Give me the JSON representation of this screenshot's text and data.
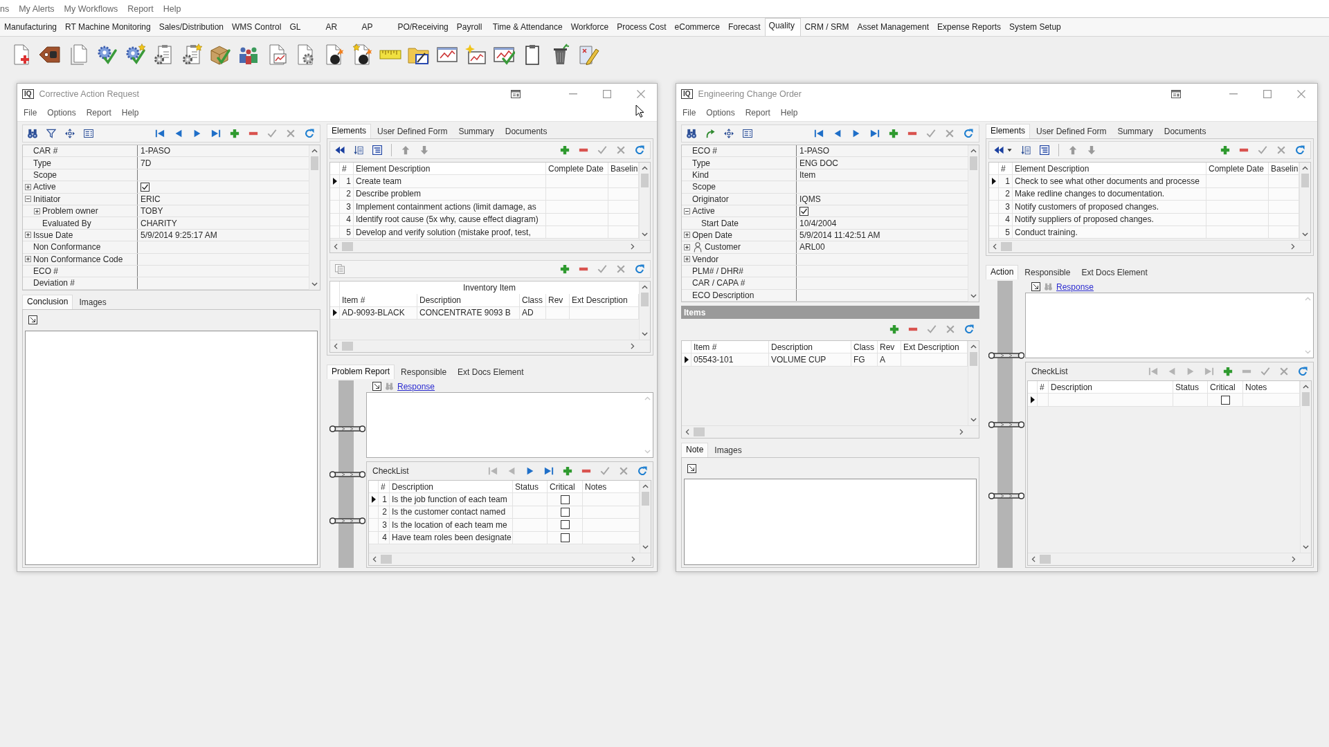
{
  "menu": [
    "ns",
    "My Alerts",
    "My Workflows",
    "Report",
    "Help"
  ],
  "modules": [
    {
      "label": "Manufacturing",
      "selected": false
    },
    {
      "label": "RT Machine Monitoring",
      "selected": false
    },
    {
      "label": "Sales/Distribution",
      "selected": false
    },
    {
      "label": "WMS Control",
      "selected": false
    },
    {
      "label": "GL",
      "selected": false
    },
    {
      "label": "AR",
      "selected": false
    },
    {
      "label": "AP",
      "selected": false
    },
    {
      "label": "PO/Receiving",
      "selected": false
    },
    {
      "label": "Payroll",
      "selected": false
    },
    {
      "label": "Time & Attendance",
      "selected": false
    },
    {
      "label": "Workforce",
      "selected": false
    },
    {
      "label": "Process Cost",
      "selected": false
    },
    {
      "label": "eCommerce",
      "selected": false
    },
    {
      "label": "Forecast",
      "selected": false
    },
    {
      "label": "Quality",
      "selected": true
    },
    {
      "label": "CRM / SRM",
      "selected": false
    },
    {
      "label": "Asset Management",
      "selected": false
    },
    {
      "label": "Expense Reports",
      "selected": false
    },
    {
      "label": "System Setup",
      "selected": false
    }
  ],
  "windows": [
    {
      "logo": "IQ",
      "title": "Corrective Action Request",
      "menu": [
        "File",
        "Options",
        "Report",
        "Help"
      ],
      "record": {
        "rows": [
          {
            "kind": "text",
            "label": "CAR #",
            "value": "1-PASO"
          },
          {
            "kind": "text",
            "label": "Type",
            "value": "7D"
          },
          {
            "kind": "text",
            "label": "Scope"
          },
          {
            "kind": "check",
            "label": "Active",
            "expanded": false,
            "checked": true
          },
          {
            "kind": "text",
            "label": "Initiator",
            "value": "ERIC",
            "expanded": true,
            "children": [
              {
                "kind": "text",
                "label": "Problem owner",
                "value": "TOBY",
                "expanded": false
              },
              {
                "kind": "text",
                "label": "Evaluated By",
                "value": "CHARITY"
              }
            ]
          },
          {
            "kind": "text",
            "label": "Issue Date",
            "value": "5/9/2014 9:25:17 AM",
            "expanded": false
          },
          {
            "kind": "text",
            "label": "Non Conformance"
          },
          {
            "kind": "text",
            "label": "Non Conformance Code",
            "expanded": false
          },
          {
            "kind": "text",
            "label": "ECO #"
          },
          {
            "kind": "text",
            "label": "Deviation #"
          }
        ]
      },
      "notes": {
        "tabs": [
          {
            "label": "Conclusion",
            "selected": true
          },
          {
            "label": "Images",
            "selected": false
          }
        ]
      },
      "elements": {
        "tabs": [
          {
            "label": "Elements",
            "selected": true
          },
          {
            "label": "User Defined Form",
            "selected": false
          },
          {
            "label": "Summary",
            "selected": false
          },
          {
            "label": "Documents",
            "selected": false
          }
        ],
        "columns": [
          "#",
          "Element Description",
          "Complete Date",
          "Baselin"
        ],
        "rows": [
          {
            "number": "1",
            "description": "Create team",
            "current": true
          },
          {
            "number": "2",
            "description": "Describe problem",
            "current": false
          },
          {
            "number": "3",
            "description": "Implement containment actions (limit damage, as",
            "current": false
          },
          {
            "number": "4",
            "description": "Identify root cause (5x why, cause effect diagram)",
            "current": false
          },
          {
            "number": "5",
            "description": "Develop and verify solution (mistake proof, test,",
            "current": false
          }
        ]
      },
      "inventory": {
        "group": "Inventory Item",
        "columns": [
          "Item #",
          "Description",
          "Class",
          "Rev",
          "Ext Description"
        ],
        "rows": [
          {
            "cells": [
              "AD-9093-BLACK",
              "CONCENTRATE 9093 B",
              "AD"
            ],
            "current": true
          }
        ]
      },
      "detail": {
        "tabs": [
          {
            "label": "Problem Report",
            "selected": true
          },
          {
            "label": "Responsible",
            "selected": false
          },
          {
            "label": "Ext Docs Element",
            "selected": false
          }
        ],
        "link": "Response",
        "checklist": {
          "title": "CheckList",
          "back_enabled": false,
          "forward_enabled": true,
          "delete_enabled": true,
          "columns": [
            "#",
            "Description",
            "Status",
            "Critical",
            "Notes"
          ],
          "rows": [
            {
              "number": "1",
              "description": "Is the job function of each team",
              "critical": false,
              "current": true
            },
            {
              "number": "2",
              "description": "Is the customer contact named",
              "critical": false,
              "current": false
            },
            {
              "number": "3",
              "description": "Is the location of each team me",
              "critical": false,
              "current": false
            },
            {
              "number": "4",
              "description": "Have team roles been designate",
              "critical": false,
              "current": false
            }
          ]
        }
      }
    },
    {
      "logo": "IQ",
      "title": "Engineering Change Order",
      "menu": [
        "File",
        "Options",
        "Report",
        "Help"
      ],
      "record": {
        "rows": [
          {
            "kind": "text",
            "label": "ECO #",
            "value": "1-PASO"
          },
          {
            "kind": "text",
            "label": "Type",
            "value": "ENG DOC"
          },
          {
            "kind": "text",
            "label": "Kind",
            "value": "Item"
          },
          {
            "kind": "text",
            "label": "Scope"
          },
          {
            "kind": "text",
            "label": "Originator",
            "value": "IQMS"
          },
          {
            "kind": "check",
            "label": "Active",
            "expanded": true,
            "checked": true,
            "children": [
              {
                "kind": "text",
                "label": "Start Date",
                "value": "10/4/2004"
              }
            ]
          },
          {
            "kind": "text",
            "label": "Open Date",
            "value": "5/9/2014 11:42:51 AM",
            "expanded": false
          },
          {
            "kind": "person",
            "label": "Customer",
            "value": "ARL00",
            "expanded": false
          },
          {
            "kind": "text",
            "label": "Vendor",
            "expanded": false
          },
          {
            "kind": "text",
            "label": "PLM# / DHR#"
          },
          {
            "kind": "text",
            "label": "CAR / CAPA #"
          },
          {
            "kind": "text",
            "label": "ECO Description"
          }
        ]
      },
      "items": {
        "title": "Items",
        "columns": [
          "Item #",
          "Description",
          "Class",
          "Rev",
          "Ext Description"
        ],
        "rows": [
          {
            "cells": [
              "05543-101",
              "VOLUME CUP",
              "FG",
              "A"
            ],
            "current": true
          }
        ]
      },
      "notes": {
        "tabs": [
          {
            "label": "Note",
            "selected": true
          },
          {
            "label": "Images",
            "selected": false
          }
        ]
      },
      "elements": {
        "tabs": [
          {
            "label": "Elements",
            "selected": true
          },
          {
            "label": "User Defined Form",
            "selected": false
          },
          {
            "label": "Summary",
            "selected": false
          },
          {
            "label": "Documents",
            "selected": false
          }
        ],
        "columns": [
          "#",
          "Element Description",
          "Complete Date",
          "Baselin"
        ],
        "rows": [
          {
            "number": "1",
            "description": "Check to see what other documents and processe",
            "current": true
          },
          {
            "number": "2",
            "description": "Make redline changes to documentation.",
            "current": false
          },
          {
            "number": "3",
            "description": "Notify customers of proposed changes.",
            "current": false
          },
          {
            "number": "4",
            "description": "Notify suppliers of proposed changes.",
            "current": false
          },
          {
            "number": "5",
            "description": "Conduct training.",
            "current": false
          }
        ]
      },
      "detail": {
        "tabs": [
          {
            "label": "Action",
            "selected": true
          },
          {
            "label": "Responsible",
            "selected": false
          },
          {
            "label": "Ext Docs Element",
            "selected": false
          }
        ],
        "link": "Response",
        "checklist": {
          "title": "CheckList",
          "back_enabled": false,
          "forward_enabled": false,
          "delete_enabled": false,
          "columns": [
            "#",
            "Description",
            "Status",
            "Critical",
            "Notes"
          ],
          "rows": [
            {
              "critical": false,
              "current": true
            }
          ]
        }
      }
    }
  ]
}
